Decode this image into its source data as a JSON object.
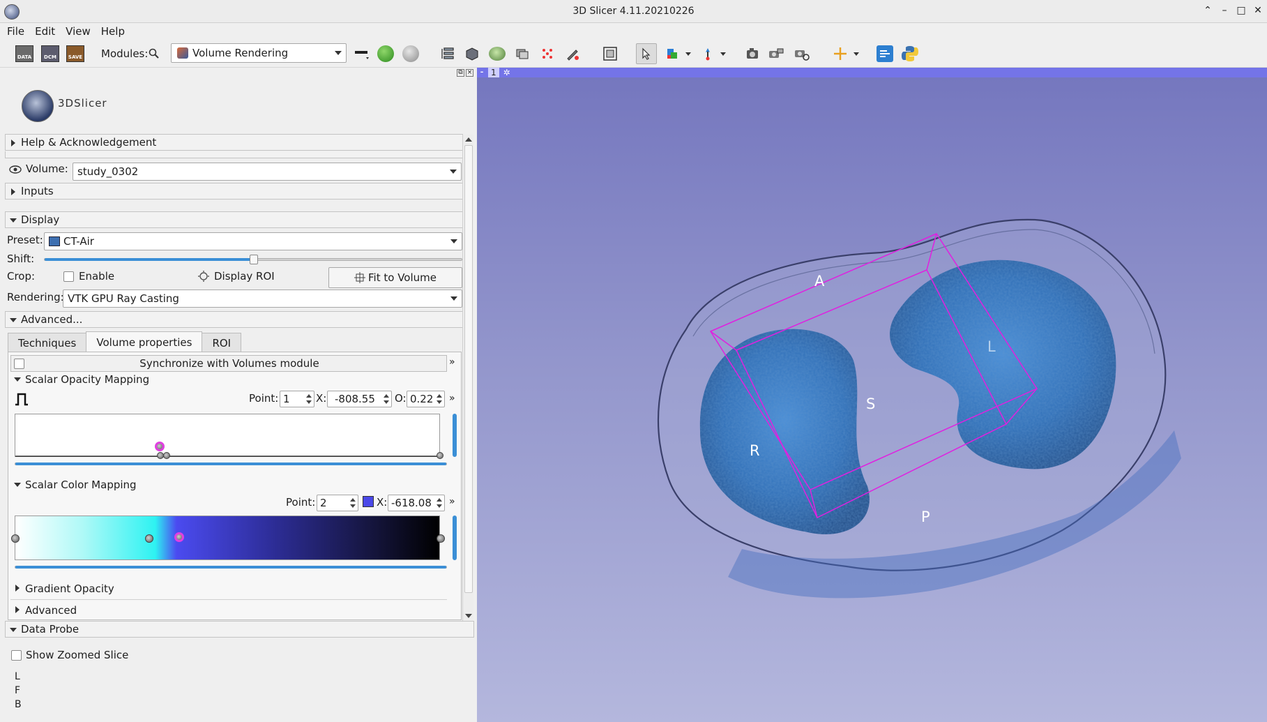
{
  "window": {
    "title": "3D Slicer 4.11.20210226"
  },
  "menu": [
    "File",
    "Edit",
    "View",
    "Help"
  ],
  "toolbar": {
    "data_label": "DATA",
    "dcm_label": "DCM",
    "save_label": "SAVE",
    "modules_label": "Modules:",
    "module_selected": "Volume Rendering"
  },
  "logo": {
    "name": "3DSlicer"
  },
  "sections": {
    "help": "Help & Acknowledgement",
    "inputs": "Inputs",
    "display": "Display",
    "advanced": "Advanced...",
    "data_probe": "Data Probe"
  },
  "volume": {
    "label": "Volume:",
    "value": "study_0302"
  },
  "display": {
    "preset_label": "Preset:",
    "preset_value": "CT-Air",
    "shift_label": "Shift:",
    "shift_fraction": 0.5,
    "crop_label": "Crop:",
    "enable_label": "Enable",
    "display_roi_label": "Display ROI",
    "fit_button": "Fit to Volume",
    "rendering_label": "Rendering:",
    "rendering_value": "VTK GPU Ray Casting"
  },
  "tabs": [
    "Techniques",
    "Volume properties",
    "ROI"
  ],
  "volume_properties": {
    "sync_label": "Synchronize with Volumes module",
    "scalar_opacity_title": "Scalar Opacity Mapping",
    "opacity_point_label": "Point:",
    "opacity_point_value": "1",
    "opacity_x_label": "X:",
    "opacity_x_value": "-808.55",
    "opacity_o_label": "O:",
    "opacity_o_value": "0.22",
    "scalar_color_title": "Scalar Color Mapping",
    "color_point_label": "Point:",
    "color_point_value": "2",
    "color_x_label": "X:",
    "color_x_value": "-618.08",
    "color_swatch": "#4a48e8",
    "gradient_title": "Gradient Opacity",
    "advanced_title": "Advanced"
  },
  "data_probe": {
    "show_zoomed": "Show Zoomed Slice",
    "rows": [
      "L",
      "F",
      "B"
    ]
  },
  "view": {
    "view_number": "1",
    "orientation": {
      "A": "A",
      "P": "P",
      "R": "R",
      "S": "S",
      "L": "L"
    },
    "roi_color": "#e020e0"
  }
}
